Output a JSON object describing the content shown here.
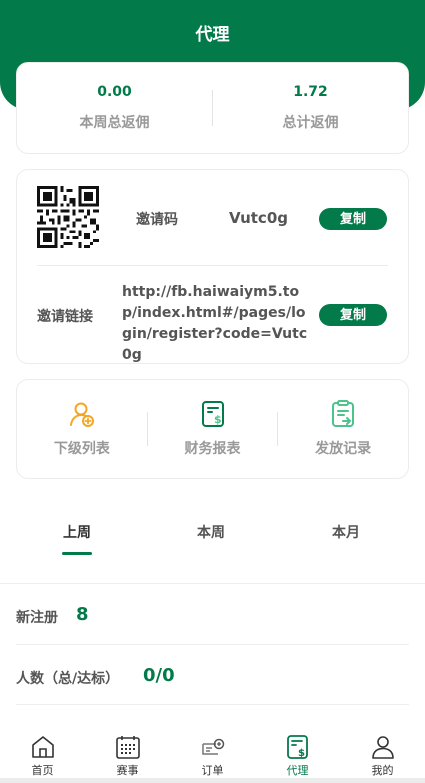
{
  "header": {
    "title": "代理"
  },
  "stats": {
    "weekly": {
      "value": "0.00",
      "label": "本周总返佣"
    },
    "total": {
      "value": "1.72",
      "label": "总计返佣"
    }
  },
  "invite": {
    "code_label": "邀请码",
    "code_value": "Vutc0g",
    "copy_label": "复制",
    "link_label": "邀请链接",
    "link_value": "http://fb.haiwaiym5.top/index.html#/pages/login/register?code=Vutc0g"
  },
  "menu": [
    {
      "label": "下级列表",
      "icon": "user-add-icon"
    },
    {
      "label": "财务报表",
      "icon": "finance-report-icon"
    },
    {
      "label": "发放记录",
      "icon": "payout-record-icon"
    }
  ],
  "tabs": [
    {
      "label": "上周",
      "active": true
    },
    {
      "label": "本周",
      "active": false
    },
    {
      "label": "本月",
      "active": false
    }
  ],
  "summary": {
    "new_register_label": "新注册",
    "new_register_value": "8",
    "people_label": "人数（总/达标）",
    "people_value": "0/0"
  },
  "nav": [
    {
      "label": "首页",
      "icon": "home-icon"
    },
    {
      "label": "赛事",
      "icon": "calendar-icon"
    },
    {
      "label": "订单",
      "icon": "order-icon"
    },
    {
      "label": "代理",
      "icon": "agent-icon",
      "active": true
    },
    {
      "label": "我的",
      "icon": "user-icon"
    }
  ],
  "colors": {
    "primary": "#037a4a",
    "orange": "#f5a623",
    "light_green": "#4cc38a"
  }
}
